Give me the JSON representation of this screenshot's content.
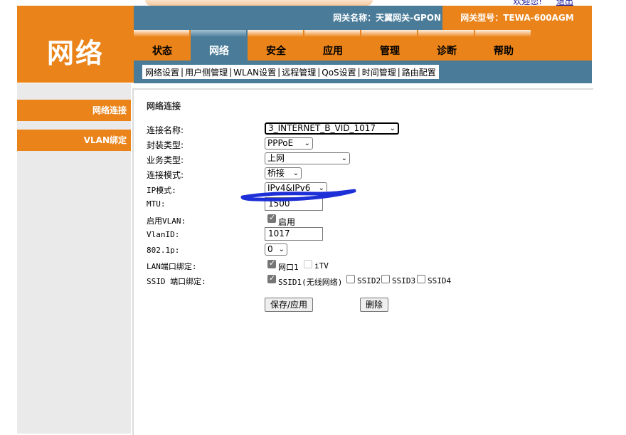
{
  "header": {
    "welcome": "欢迎您!",
    "logout": "退出",
    "logo": "网络",
    "gateway_name": "网关名称：天翼网关-GPON",
    "gateway_model": "网关型号：TEWA-600AGM"
  },
  "tabs": [
    {
      "label": "状态",
      "active": false
    },
    {
      "label": "网络",
      "active": true
    },
    {
      "label": "安全",
      "active": false
    },
    {
      "label": "应用",
      "active": false
    },
    {
      "label": "管理",
      "active": false
    },
    {
      "label": "诊断",
      "active": false
    },
    {
      "label": "帮助",
      "active": false
    }
  ],
  "subnav": [
    "网络设置",
    "用户侧管理",
    "WLAN设置",
    "远程管理",
    "QoS设置",
    "时间管理",
    "路由配置"
  ],
  "sidebar": {
    "items": [
      {
        "label": "网络连接"
      },
      {
        "label": "VLAN绑定"
      }
    ]
  },
  "form": {
    "title": "网络连接",
    "connection_name_label": "连接名称:",
    "connection_name_value": "3_INTERNET_B_VID_1017",
    "encap_label": "封装类型:",
    "encap_value": "PPPoE",
    "service_label": "业务类型:",
    "service_value": "上网",
    "mode_label": "连接模式:",
    "mode_value": "桥接",
    "ip_mode_label": "IP模式:",
    "ip_mode_value": "IPv4&IPv6",
    "mtu_label": "MTU:",
    "mtu_value": "1500",
    "vlan_enable_label": "启用VLAN:",
    "vlan_enable_text": "启用",
    "vlan_id_label": "VlanID:",
    "vlan_id_value": "1017",
    "p8021_label": "802.1p:",
    "p8021_value": "0",
    "lan_bind_label": "LAN端口绑定:",
    "lan_port1": "网口1",
    "lan_itv": "iTV",
    "ssid_bind_label": "SSID 端口绑定:",
    "ssid1": "SSID1(无线网络)",
    "ssid2": "SSID2",
    "ssid3": "SSID3",
    "ssid4": "SSID4",
    "save_button": "保存/应用",
    "delete_button": "删除"
  },
  "colors": {
    "orange": "#ea8319",
    "steel_blue": "#4a7c99",
    "annotation_blue": "#1d2fd6"
  }
}
